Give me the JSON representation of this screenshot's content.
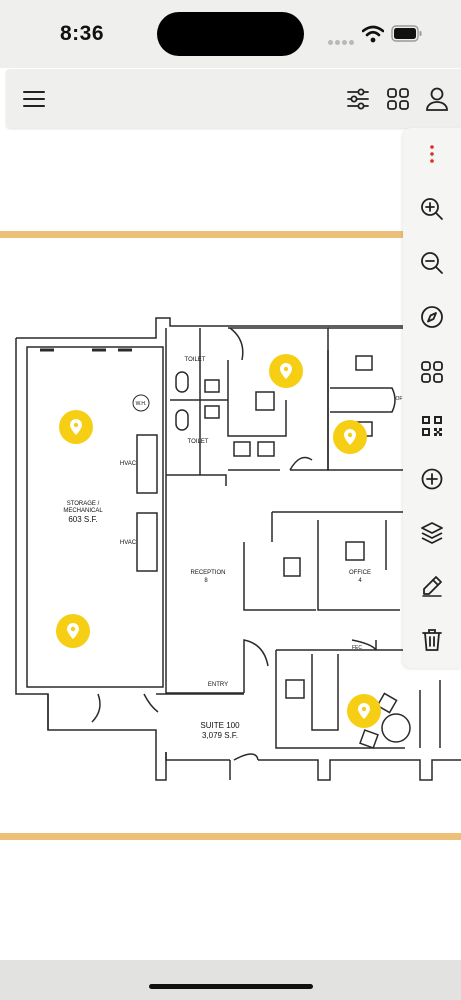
{
  "status_bar": {
    "time": "8:36"
  },
  "app_bar": {
    "menu_icon": "hamburger-menu-icon",
    "actions": [
      "sliders-icon",
      "grid-icon",
      "user-icon"
    ]
  },
  "toolbar": {
    "items": [
      "more-vertical-icon",
      "zoom-in-icon",
      "zoom-out-icon",
      "compass-icon",
      "grid-icon",
      "qr-code-icon",
      "add-circle-icon",
      "layers-icon",
      "edit-icon",
      "trash-icon"
    ],
    "accent_color": "#d93025"
  },
  "floor_plan": {
    "labels": {
      "storage": "STORAGE /",
      "mechanical": "MECHANICAL",
      "storage_area": "603 S.F.",
      "wh": "W.H.",
      "hvac_1": "HVAC",
      "hvac_2": "HVAC",
      "toilet_1": "TOILET",
      "toilet_2": "TOILET",
      "reception": "RECEPTION",
      "reception_num": "8",
      "office": "OFFICE",
      "office_num": "4",
      "entry": "ENTRY",
      "suite": "SUITE 100",
      "suite_area": "3,079 S.F.",
      "fec": "FEC",
      "partial_o": "OF"
    },
    "band_color": "#edc07a",
    "pin_color": "#f6cf14",
    "pins": 5
  }
}
